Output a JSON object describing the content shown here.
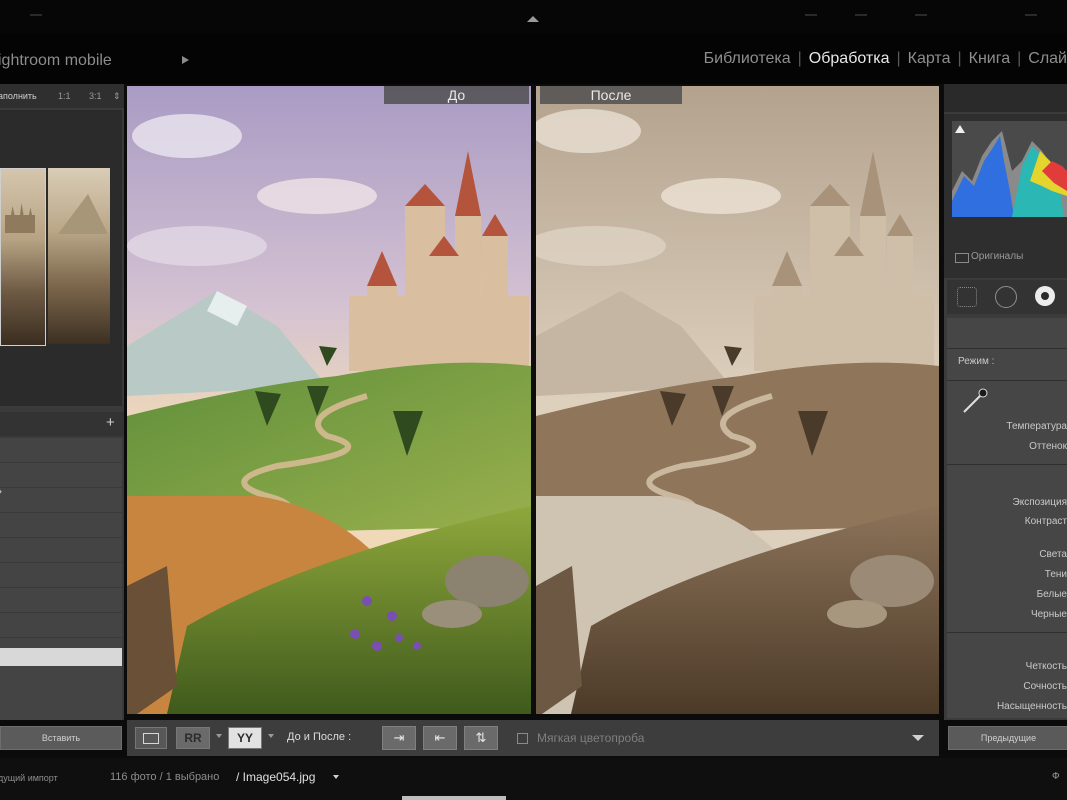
{
  "app": {
    "brand": "ightroom mobile"
  },
  "modules": [
    {
      "label": "Библиотека",
      "active": false
    },
    {
      "label": "Обработка",
      "active": true
    },
    {
      "label": "Карта",
      "active": false
    },
    {
      "label": "Книга",
      "active": false
    },
    {
      "label": "Слай",
      "active": false
    }
  ],
  "navigator": {
    "fill_label": "аполнить",
    "zoom_1": "1:1",
    "zoom_2": "3:1"
  },
  "left_panel": {
    "paste_button": "Вставить"
  },
  "view": {
    "before_label": "До",
    "after_label": "После"
  },
  "right_panel": {
    "originals_label": "Оригиналы",
    "mode_label": "Режим :",
    "temperature_label": "Температура",
    "tint_label": "Оттенок",
    "exposure_label": "Экспозиция",
    "contrast_label": "Контраст",
    "highlights_label": "Света",
    "shadows_label": "Тени",
    "whites_label": "Белые",
    "blacks_label": "Черные",
    "clarity_label": "Четкость",
    "vibrance_label": "Сочность",
    "saturation_label": "Насыщенность",
    "previous_button": "Предыдущие"
  },
  "toolbar": {
    "rr_label": "RR",
    "yy_label": "YY",
    "before_after_label": "До и После :",
    "softproof_label": "Мягкая цветопроба"
  },
  "filmstrip": {
    "source_label": "дущий импорт",
    "count_label": "116 фото / 1 выбрано",
    "file_label": "/ Image054.jpg",
    "filter_label": "Ф"
  }
}
